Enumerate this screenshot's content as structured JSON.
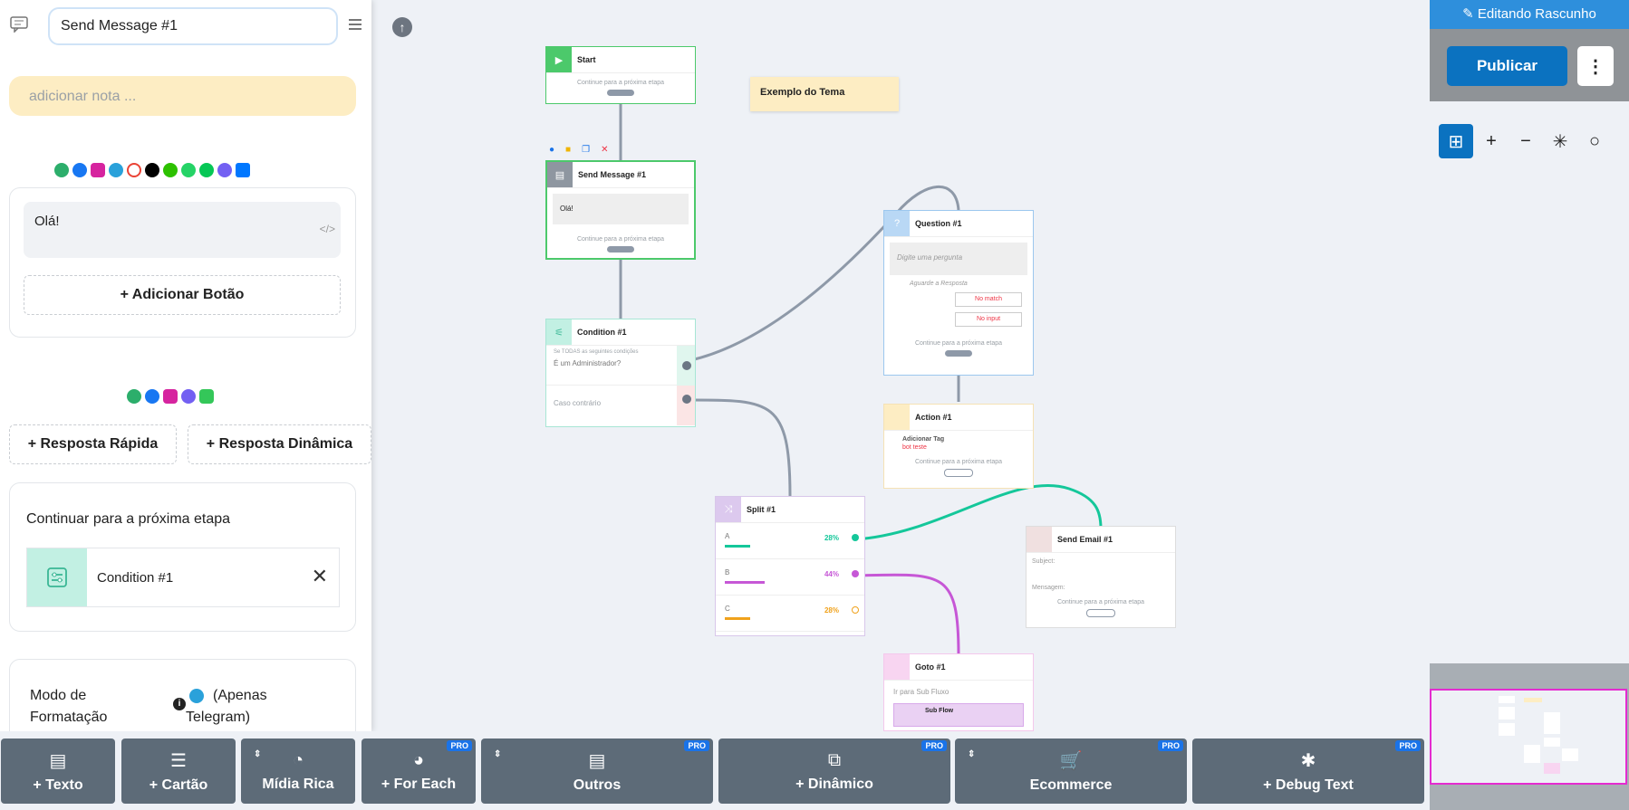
{
  "sidebar": {
    "title_value": "Send Message #1",
    "note_placeholder": "adicionar nota ...",
    "message_text": "Olá!",
    "add_button_label": "+ Adicionar Botão",
    "quick_reply_label": "+ Resposta Rápida",
    "dynamic_reply_label": "+ Resposta Dinâmica",
    "continue_heading": "Continuar para a próxima etapa",
    "next_step_name": "Condition #1",
    "format_mode_label": "Modo de Formatação",
    "telegram_only_label": "(Apenas Telegram)"
  },
  "canvas": {
    "sticky_note": "Exemplo do Tema",
    "continue_text": "Continue para a próxima etapa",
    "start": {
      "title": "Start"
    },
    "send_message": {
      "title": "Send Message #1",
      "text": "Olá!"
    },
    "condition": {
      "title": "Condition #1",
      "rule_line1": "Se TODAS as seguintes condições",
      "rule_line2": "É um Administrador?",
      "else_text": "Caso contrário"
    },
    "question": {
      "title": "Question #1",
      "placeholder": "Digite uma pergunta",
      "wait_label": "Aguarde a Resposta",
      "no_match": "No match",
      "no_input": "No input"
    },
    "action": {
      "title": "Action #1",
      "action_name": "Adicionar Tag",
      "tag_value": "bot teste"
    },
    "split": {
      "title": "Split #1",
      "branches": [
        {
          "label": "A",
          "percent": "28%",
          "color": "#14c79a"
        },
        {
          "label": "B",
          "percent": "44%",
          "color": "#c657d6"
        },
        {
          "label": "C",
          "percent": "28%",
          "color": "#f0a21c"
        }
      ]
    },
    "email": {
      "title": "Send Email #1",
      "subject_label": "Subject:",
      "message_label": "Mensagem:"
    },
    "goto": {
      "title": "Goto #1",
      "subtitle": "Ir para Sub Fluxo",
      "subflow": "Sub Flow"
    }
  },
  "toolbar": {
    "items": [
      {
        "label": "+ Texto"
      },
      {
        "label": "+ Cartão"
      },
      {
        "label": "Mídia Rica"
      },
      {
        "label": "+ For Each",
        "badge": "PRO"
      },
      {
        "label": "Outros",
        "badge": "PRO"
      },
      {
        "label": "+ Dinâmico",
        "badge": "PRO"
      },
      {
        "label": "Ecommerce",
        "badge": "PRO"
      },
      {
        "label": "+ Debug Text",
        "badge": "PRO"
      }
    ]
  },
  "right_panel": {
    "editing_label": "Editando Rascunho",
    "publish_label": "Publicar"
  },
  "colors": {
    "accent": "#0b72c0",
    "toolbar": "#5d6b78",
    "note": "#fdedc3",
    "connector": "#8e99a8",
    "split_a": "#14c79a",
    "split_b": "#c657d6"
  }
}
